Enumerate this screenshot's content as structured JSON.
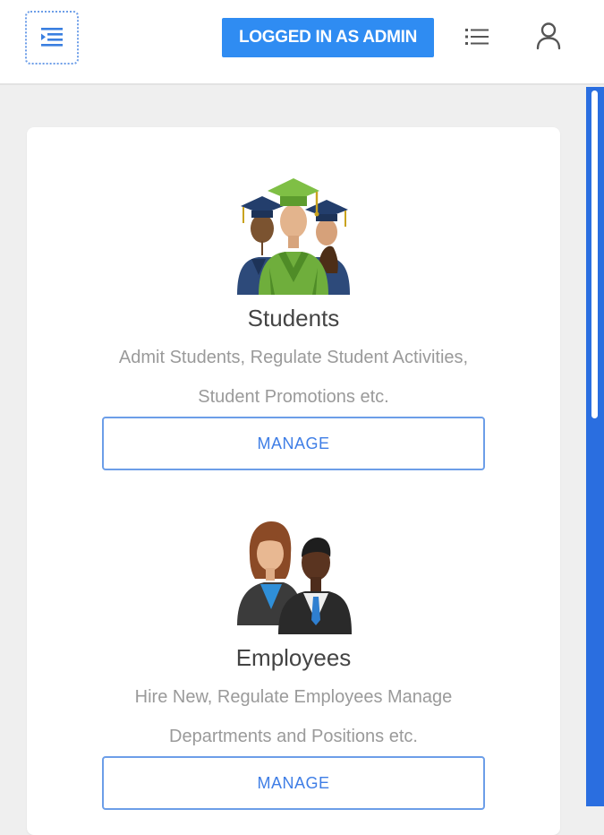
{
  "header": {
    "badge": "LOGGED IN AS ADMIN",
    "menu_toggle_icon": "menu-indent-icon",
    "list_icon": "list-icon",
    "user_icon": "user-icon",
    "accent_color": "#2f8cf2"
  },
  "modules": [
    {
      "icon": "graduates-icon",
      "title": "Students",
      "description": "Admit Students, Regulate Student Activities, Student Promotions etc.",
      "button": "MANAGE"
    },
    {
      "icon": "employees-icon",
      "title": "Employees",
      "description": "Hire New, Regulate Employees Manage Departments and Positions etc.",
      "button": "MANAGE"
    }
  ]
}
